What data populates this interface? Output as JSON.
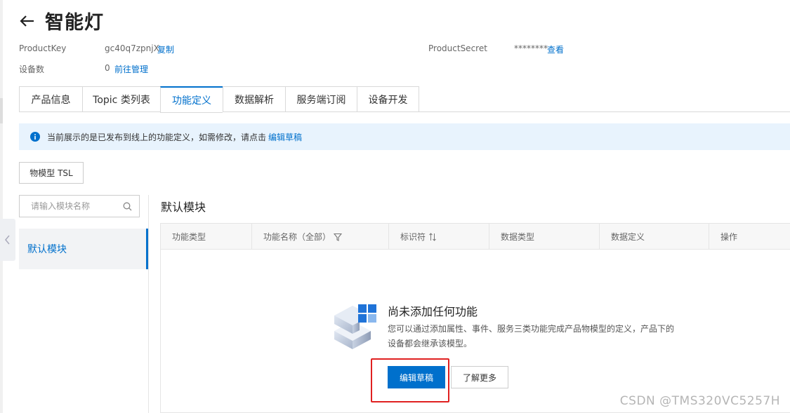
{
  "header": {
    "back_label": "←",
    "title": "智能灯"
  },
  "meta": {
    "product_key_label": "ProductKey",
    "product_key_value": "gc40q7zpnjX",
    "copy_link": "复制",
    "product_secret_label": "ProductSecret",
    "product_secret_value": "********",
    "view_link": "查看",
    "device_count_label": "设备数",
    "device_count_value": "0",
    "manage_link": "前往管理"
  },
  "tabs": [
    {
      "label": "产品信息"
    },
    {
      "label": "Topic 类列表"
    },
    {
      "label": "功能定义",
      "active": true
    },
    {
      "label": "数据解析"
    },
    {
      "label": "服务端订阅"
    },
    {
      "label": "设备开发"
    }
  ],
  "notice": {
    "text": "当前展示的是已发布到线上的功能定义，如需修改，请点击",
    "link": "编辑草稿"
  },
  "tsl_button": "物模型 TSL",
  "search": {
    "placeholder": "请输入模块名称"
  },
  "modules": [
    {
      "label": "默认模块"
    }
  ],
  "section_title": "默认模块",
  "table": {
    "columns": [
      "功能类型",
      "功能名称（全部）",
      "标识符",
      "数据类型",
      "数据定义",
      "操作"
    ]
  },
  "empty": {
    "title": "尚未添加任何功能",
    "description": "您可以通过添加属性、事件、服务三类功能完成产品物模型的定义，产品下的设备都会继承该模型。",
    "primary_button": "编辑草稿",
    "secondary_button": "了解更多"
  },
  "watermark": "CSDN @TMS320VC5257H",
  "colors": {
    "accent": "#0070cc",
    "notice_bg": "#e8f3fd",
    "highlight": "#e02020"
  }
}
